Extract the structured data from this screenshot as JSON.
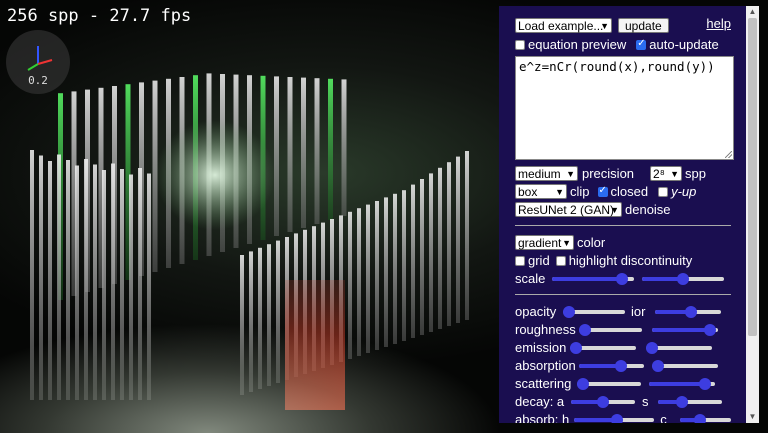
{
  "stats": {
    "text": "256 spp - 27.7 fps"
  },
  "gizmo": {
    "scale": "0.2"
  },
  "panel": {
    "load_example": "Load example...",
    "update_label": "update",
    "help_label": "help",
    "equation_preview_label": "equation preview",
    "equation_preview_checked": false,
    "auto_update_label": "auto-update",
    "auto_update_checked": true,
    "equation": "e^z=nCr(round(x),round(y))",
    "precision_value": "medium",
    "precision_label": "precision",
    "spp_value": "2⁸",
    "spp_label": "spp",
    "clip_value": "box",
    "clip_label": "clip",
    "closed_label": "closed",
    "closed_checked": true,
    "yup_label": "y-up",
    "yup_checked": false,
    "denoise_value": "ResUNet 2 (GAN)",
    "denoise_label": "denoise",
    "color_value": "gradient",
    "color_label": "color",
    "grid_label": "grid",
    "grid_checked": false,
    "highlight_label": "highlight discontinuity",
    "highlight_checked": false,
    "scale_label": "scale",
    "scale_a": 0.92,
    "scale_b": 0.5,
    "opacity_label": "opacity",
    "opacity_value": 0.0,
    "ior_label": "ior",
    "ior_value": 0.55,
    "roughness_label": "roughness",
    "roughness_a": 0.0,
    "roughness_b": 0.97,
    "emission_label": "emission",
    "emission_a": 0.0,
    "emission_b": 0.0,
    "absorption_label": "absorption",
    "absorption_a": 0.68,
    "absorption_b": 0.0,
    "scattering_label": "scattering",
    "scattering_a": 0.0,
    "scattering_b": 0.93,
    "decay_label": "decay: a",
    "decay_a": 0.5,
    "decay_s_label": "s",
    "decay_s": 0.35,
    "absorb_label": "absorb: h",
    "absorb_h": 0.55,
    "absorb_c_label": "c",
    "absorb_c": 0.35
  },
  "colors": {
    "panel_bg": "#1a0e50",
    "slider_accent": "#3d3de0"
  }
}
